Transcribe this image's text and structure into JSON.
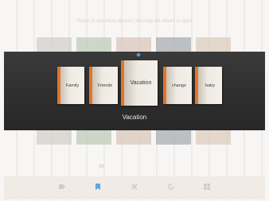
{
  "header": {
    "hint_text": "Swipe to see more albums, then tap the album to open"
  },
  "albums": {
    "items": [
      {
        "label": "Family"
      },
      {
        "label": "Friends"
      },
      {
        "label": "Vacation"
      },
      {
        "label": "change"
      },
      {
        "label": "baby"
      }
    ],
    "selected_caption": "Vacation"
  },
  "footer": {
    "count": "1/5",
    "toolbar_icons": [
      "tag-icon",
      "bookmark-icon",
      "delete-icon",
      "rotate-icon",
      "grid-icon"
    ]
  },
  "colors": {
    "accent": "#5aa7e6",
    "spine": "#e2752a",
    "band": "#2f2f2f"
  }
}
